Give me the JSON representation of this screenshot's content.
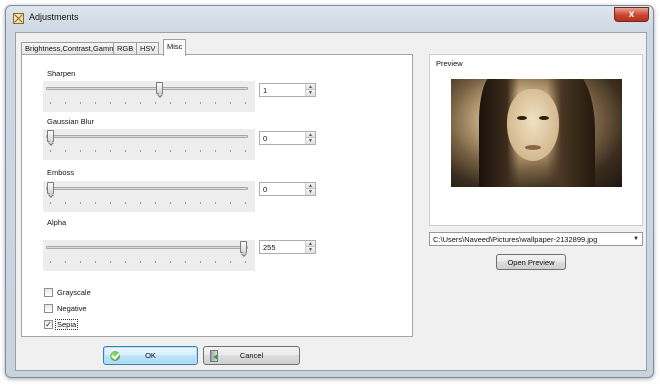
{
  "window": {
    "title": "Adjustments",
    "close_glyph": "x",
    "app_icon": "adjustments-app-icon",
    "accent_color": "#3c7fb1"
  },
  "tabs": [
    {
      "label": "Brightness,Contrast,Gamma",
      "active": false
    },
    {
      "label": "RGB",
      "active": false
    },
    {
      "label": "HSV",
      "active": false
    },
    {
      "label": "Misc",
      "active": true
    }
  ],
  "misc": {
    "sharpen": {
      "label": "Sharpen",
      "value": "1",
      "slider_level": 0.5
    },
    "gaussian_blur": {
      "label": "Gaussian Blur",
      "value": "0",
      "slider_level": 0.0
    },
    "emboss": {
      "label": "Emboss",
      "value": "0",
      "slider_level": 0.0
    },
    "alpha": {
      "label": "Alpha",
      "value": "255",
      "slider_level": 1.0
    },
    "checkboxes": [
      {
        "label": "Grayscale",
        "checked": false
      },
      {
        "label": "Negative",
        "checked": false
      },
      {
        "label": "Sepia",
        "checked": true
      }
    ],
    "check_glyph": "✓"
  },
  "preview": {
    "title": "Preview",
    "image_description_icon": "portrait-photo-sepia",
    "path": "C:\\Users\\Naveed\\Pictures\\wallpaper-2132899.jpg",
    "dropdown_glyph": "▼",
    "open_preview_label": "Open Preview"
  },
  "buttons": {
    "ok_label": "OK",
    "cancel_label": "Cancel"
  },
  "spin_glyphs": {
    "up": "▲",
    "down": "▼"
  }
}
